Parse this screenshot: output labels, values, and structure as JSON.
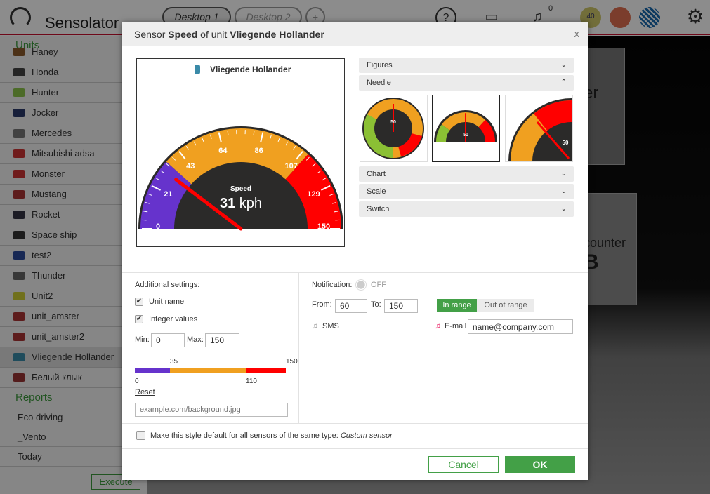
{
  "app": {
    "title": "Sensolator",
    "desktops": [
      "Desktop 1",
      "Desktop 2"
    ],
    "add_desktop": "+",
    "help": "?",
    "notifications_count": "0",
    "badge_40": "40"
  },
  "sidebar": {
    "units_title": "Units",
    "units": [
      {
        "name": "Haney",
        "color": "#8a5a2a"
      },
      {
        "name": "Honda",
        "color": "#444"
      },
      {
        "name": "Hunter",
        "color": "#8bc34a"
      },
      {
        "name": "Jocker",
        "color": "#2a3a6a"
      },
      {
        "name": "Mercedes",
        "color": "#777"
      },
      {
        "name": "Mitsubishi adsa",
        "color": "#c33"
      },
      {
        "name": "Monster",
        "color": "#c33"
      },
      {
        "name": "Mustang",
        "color": "#a33"
      },
      {
        "name": "Rocket",
        "color": "#334"
      },
      {
        "name": "Space ship",
        "color": "#333"
      },
      {
        "name": "test2",
        "color": "#2a4a9a"
      },
      {
        "name": "Thunder",
        "color": "#666"
      },
      {
        "name": "Unit2",
        "color": "#cc3"
      },
      {
        "name": "unit_amster",
        "color": "#a33"
      },
      {
        "name": "unit_amster2",
        "color": "#a33"
      },
      {
        "name": "Vliegende Hollander",
        "color": "#3a8aa8"
      },
      {
        "name": "Белый клык",
        "color": "#933"
      }
    ],
    "reports_title": "Reports",
    "reports": [
      "Eco driving",
      "_Vento",
      "Today"
    ],
    "execute": "Execute"
  },
  "background": {
    "widget1_text": "er",
    "widget2_text": "counter",
    "widget2_value": "B"
  },
  "dialog": {
    "title_prefix": "Sensor ",
    "sensor": "Speed",
    "title_mid": " of unit ",
    "unit": "Vliegende Hollander",
    "close": "x",
    "preview": {
      "unit_name": "Vliegende Hollander",
      "label": "Speed",
      "value": "31",
      "unit": "kph"
    },
    "accordion": {
      "figures": "Figures",
      "needle": "Needle",
      "chart": "Chart",
      "scale": "Scale",
      "switch": "Switch"
    },
    "thumb_values": [
      "50",
      "50",
      "50"
    ],
    "additional": {
      "title": "Additional settings:",
      "unit_name": "Unit name",
      "unit_name_checked": true,
      "integer_values": "Integer values",
      "integer_checked": true,
      "min_label": "Min:",
      "min": "0",
      "max_label": "Max:",
      "max": "150",
      "reset": "Reset",
      "bg_placeholder": "example.com/background.jpg"
    },
    "notification": {
      "label": "Notification:",
      "state": "OFF",
      "from_label": "From:",
      "from": "60",
      "to_label": "To:",
      "to": "150",
      "in_range": "In range",
      "out_of_range": "Out of range",
      "sms": "SMS",
      "email": "E-mail",
      "email_value": "name@company.com"
    },
    "default_label": "Make this style default for all sensors of the same type: ",
    "sensor_type": "Custom sensor",
    "cancel": "Cancel",
    "ok": "OK"
  },
  "chart_data": {
    "type": "gauge",
    "min": 0,
    "max": 150,
    "value": 31,
    "ticks": [
      "0",
      "21",
      "43",
      "64",
      "86",
      "107",
      "129",
      "150"
    ],
    "bands": [
      {
        "from": 0,
        "to": 35,
        "color": "#6633cc"
      },
      {
        "from": 35,
        "to": 110,
        "color": "#f0a020"
      },
      {
        "from": 110,
        "to": 150,
        "color": "#ff0000"
      }
    ],
    "band_labels": {
      "b1": "35",
      "b2": "110",
      "min": "0",
      "max": "150"
    }
  }
}
